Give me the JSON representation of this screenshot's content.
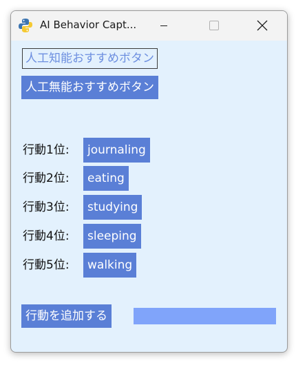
{
  "window": {
    "title": "AI Behavior Capt...",
    "app_icon": "python-icon"
  },
  "main": {
    "ai_button_label": "人工知能おすすめボタン",
    "dumb_button_label": "人工無能おすすめボタン",
    "ranking": [
      {
        "rank_label": "行動1位:",
        "action": "journaling"
      },
      {
        "rank_label": "行動2位:",
        "action": "eating"
      },
      {
        "rank_label": "行動3位:",
        "action": "studying"
      },
      {
        "rank_label": "行動4位:",
        "action": "sleeping"
      },
      {
        "rank_label": "行動5位:",
        "action": "walking"
      }
    ],
    "add_button_label": "行動を追加する",
    "add_input_value": ""
  },
  "colors": {
    "accent": "#5a7fd6",
    "input_bg": "#80a4fa",
    "window_bg": "#e3f1fd",
    "ai_button_text": "#6d8fe0"
  }
}
